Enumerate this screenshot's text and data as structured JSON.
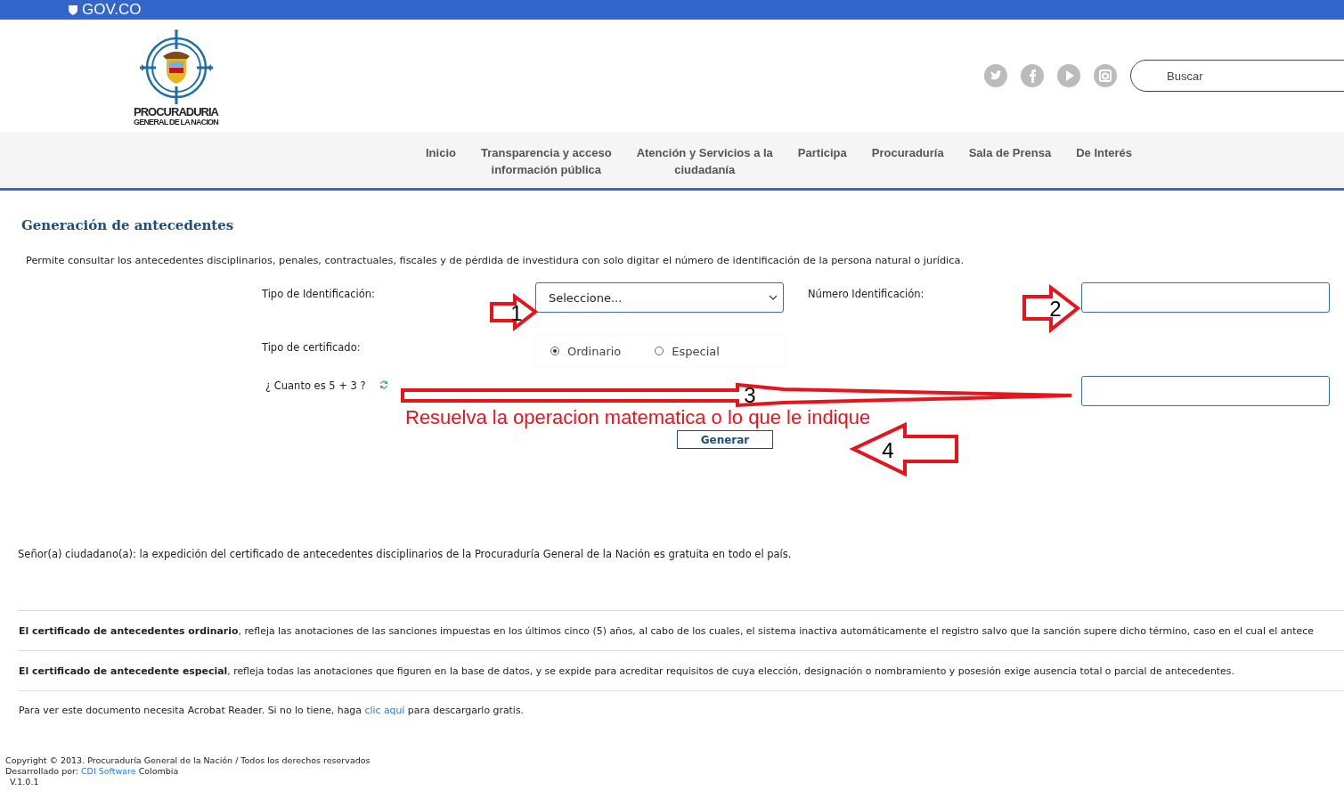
{
  "topbar": {
    "brand": "GOV.CO"
  },
  "logo": {
    "line1": "PROCURADURIA",
    "line2": "GENERAL DE LA NACION"
  },
  "social": [
    {
      "kind": "twitter"
    },
    {
      "kind": "facebook"
    },
    {
      "kind": "youtube"
    },
    {
      "kind": "instagram"
    }
  ],
  "search": {
    "placeholder": "Buscar"
  },
  "nav": [
    {
      "label": "Inicio"
    },
    {
      "label": "Transparencia y acceso\ninformación pública"
    },
    {
      "label": "Atención y Servicios a la\nciudadanía"
    },
    {
      "label": "Participa"
    },
    {
      "label": "Procuraduría"
    },
    {
      "label": "Sala de Prensa"
    },
    {
      "label": "De Interés"
    }
  ],
  "page_title": "Generación de antecedentes",
  "description": "Permite consultar los antecedentes disciplinarios, penales, contractuales, fiscales y de pérdida de investidura con solo digitar el número de identificación de la persona natural o jurídica.",
  "form": {
    "id_type_label": "Tipo de Identificación:",
    "id_type_value": "Seleccione...",
    "id_number_label": "Número Identificación:",
    "cert_type_label": "Tipo de certificado:",
    "cert_options": [
      {
        "label": "Ordinario",
        "selected": true
      },
      {
        "label": "Especial",
        "selected": false
      }
    ],
    "captcha_label": "¿ Cuanto es 5 + 3 ?",
    "submit": "Generar"
  },
  "notice": "Señor(a) ciudadano(a): la expedición del certificado de antecedentes disciplinarios de la Procuraduría General de la Nación es gratuita en todo el país.",
  "info": [
    "**El certificado de antecedentes ordinario**, refleja las anotaciones de las sanciones impuestas en los últimos cinco (5) años, al cabo de los cuales, el sistema inactiva automáticamente el registro salvo que la sanción supere dicho término, caso en el cual el antece",
    "**El certificado de antecedente especial**, refleja todas las anotaciones que figuren en la base de datos, y se expide para acreditar requisitos de cuya elección, designación o nombramiento y posesión exige ausencia total o parcial de antecedentes."
  ],
  "acrobat": {
    "before": "Para ver este documento necesita Acrobat Reader. Si no lo tiene, haga",
    "link": "clic aquí",
    "after": "para descargarlo gratis."
  },
  "footer": {
    "copyright": "Copyright © 2013. Procuraduría General de la Nación / Todos los derechos reservados",
    "dev_before": "Desarrollado por:",
    "dev_link": "CDI Software",
    "dev_after": "Colombia",
    "version": "V.1.0.1"
  },
  "annotations": {
    "numbers": [
      "1",
      "2",
      "3",
      "4"
    ],
    "text": "Resuelva la operacion matematica o lo que le indique"
  }
}
